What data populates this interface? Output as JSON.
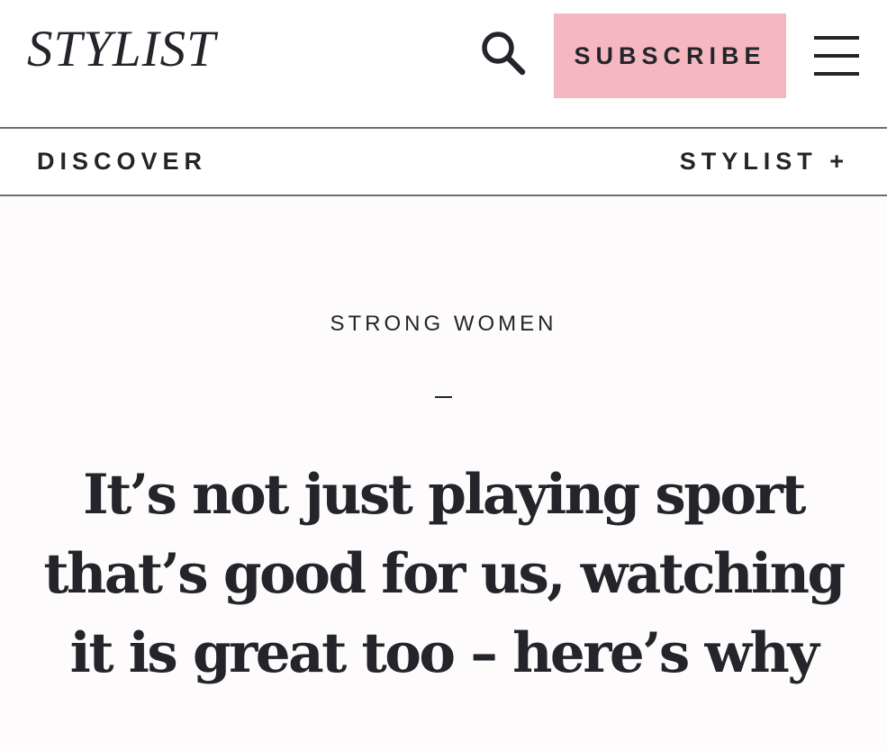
{
  "header": {
    "logo": "STYLIST",
    "subscribe_label": "SUBSCRIBE",
    "search_icon": "search-icon",
    "menu_icon": "hamburger-menu-icon",
    "subscribe_color": "#f5b8c0"
  },
  "subnav": {
    "discover_label": "DISCOVER",
    "stylist_plus_label": "STYLIST +"
  },
  "article": {
    "category": "STRONG WOMEN",
    "headline": "It’s not just playing sport that’s good for us, watching it is great too – here’s why"
  }
}
